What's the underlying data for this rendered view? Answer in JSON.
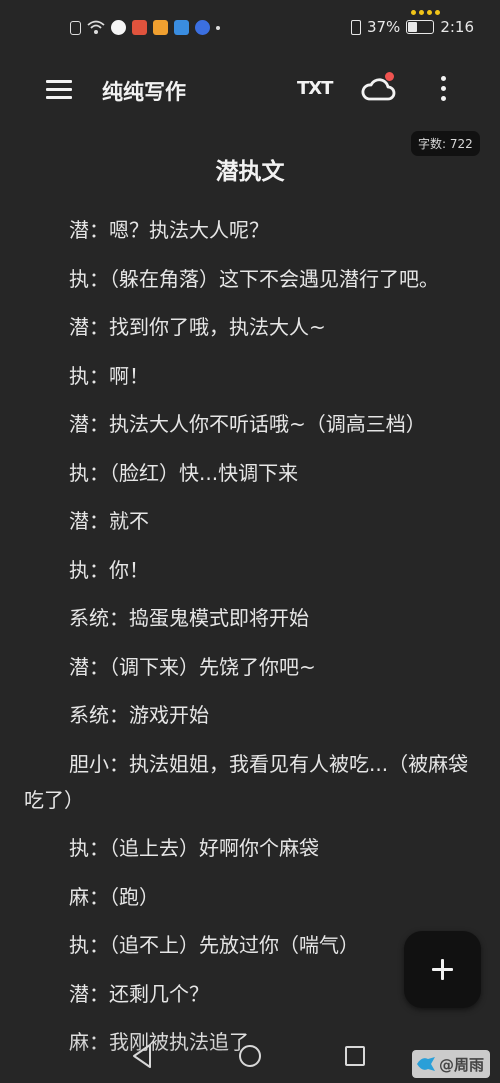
{
  "status_bar": {
    "battery_text": "37%",
    "battery_level": 0.37,
    "time": "2:16"
  },
  "app_bar": {
    "title": "纯纯写作",
    "txt_label": "TXT"
  },
  "word_count": "字数: 722",
  "document": {
    "title": "潜执文",
    "paragraphs": [
      "潜：嗯？执法大人呢？",
      "执：（躲在角落）这下不会遇见潜行了吧。",
      "潜：找到你了哦，执法大人~",
      "执：啊！",
      "潜：执法大人你不听话哦~（调高三档）",
      "执：（脸红）快...快调下来",
      "潜：就不",
      "执：你！",
      "系统：捣蛋鬼模式即将开始",
      "潜：（调下来）先饶了你吧~",
      "系统：游戏开始",
      "胆小：执法姐姐，我看见有人被吃...（被麻袋吃了）",
      "执：（追上去）好啊你个麻袋",
      "麻：（跑）",
      "执：（追不上）先放过你（喘气）",
      "潜：还剩几个？",
      "麻：我刚被执法追了"
    ]
  },
  "watermark": "@周雨",
  "colors": {
    "background": "#262626",
    "text": "#e6e6e6",
    "notification_dot": "#ef5350",
    "fab_background": "#111111"
  }
}
